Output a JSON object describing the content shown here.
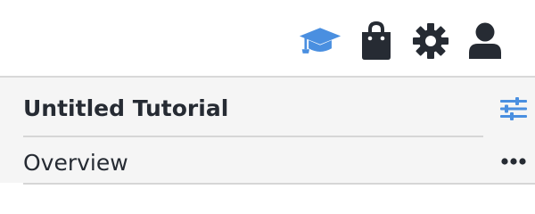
{
  "header_icons": [
    {
      "name": "graduation-cap-icon",
      "color": "#4a8fe0"
    },
    {
      "name": "shopping-bag-icon",
      "color": "#262b33"
    },
    {
      "name": "gear-icon",
      "color": "#262b33"
    },
    {
      "name": "user-icon",
      "color": "#262b33"
    }
  ],
  "panel": {
    "title": "Untitled Tutorial",
    "filter_icon": "sliders-icon",
    "filter_color": "#4a8fe0",
    "items": [
      {
        "label": "Overview",
        "menu_icon": "more-horizontal-icon"
      }
    ]
  }
}
